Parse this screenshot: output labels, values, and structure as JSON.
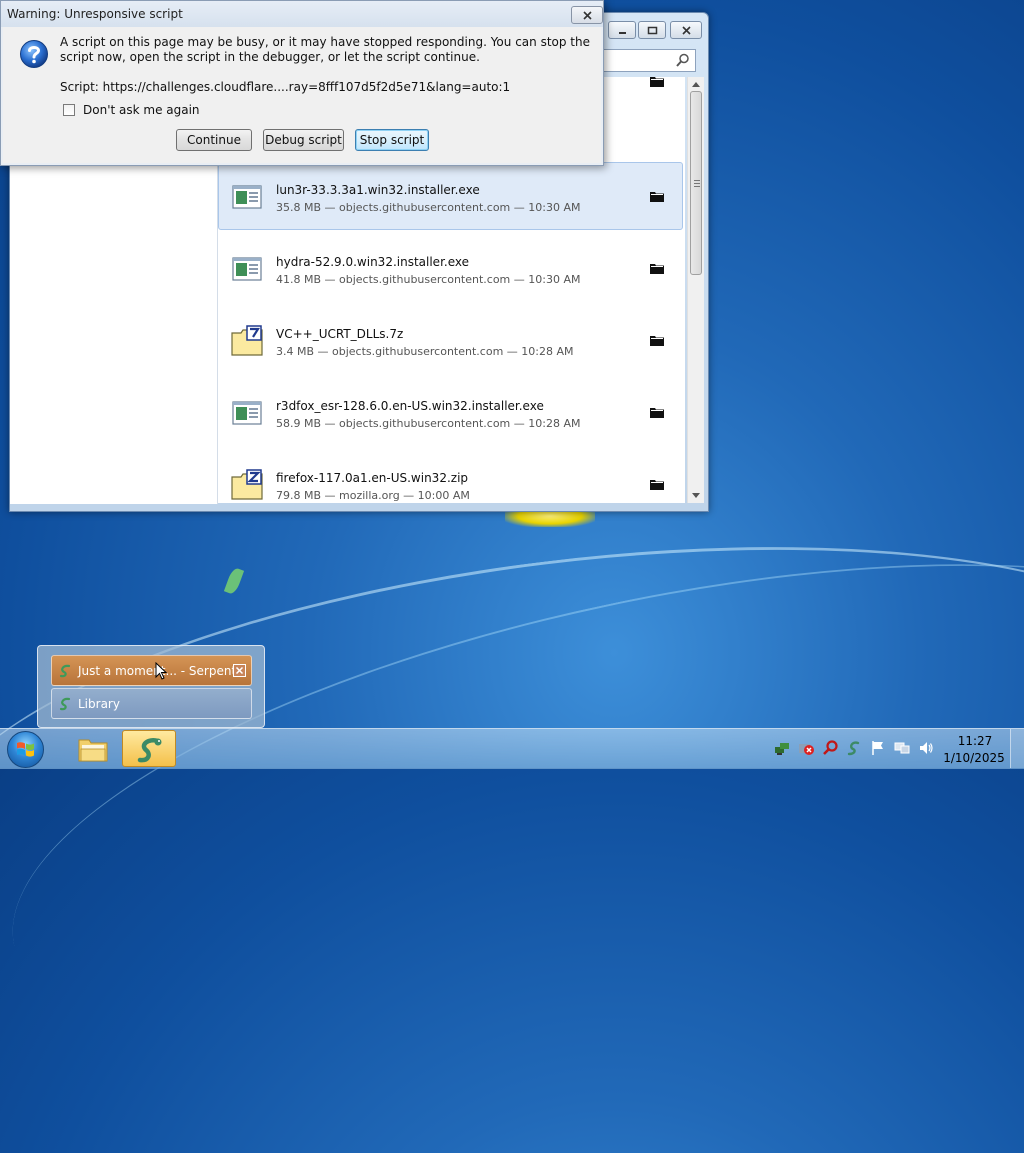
{
  "dialog": {
    "title": "Warning: Unresponsive script",
    "message": "A script on this page may be busy, or it may have stopped responding. You can stop the script now, open the script in the debugger, or let the script continue.",
    "script_line": "Script: https://challenges.cloudflare....ray=8fff107d5f2d5e71&lang=auto:1",
    "checkbox_label": "Don't ask me again",
    "checkbox_checked": false,
    "buttons": {
      "continue": "Continue",
      "debug": "Debug script",
      "stop": "Stop script"
    }
  },
  "downloads": [
    {
      "name": "lun3r-33.3.3a1.win32.installer.exe",
      "status": "35.8 MB — objects.githubusercontent.com — 10:30 AM",
      "icon": "exe-icon",
      "selected": true
    },
    {
      "name": "hydra-52.9.0.win32.installer.exe",
      "status": "41.8 MB — objects.githubusercontent.com — 10:30 AM",
      "icon": "exe-icon",
      "selected": false
    },
    {
      "name": "VC++_UCRT_DLLs.7z",
      "status": "3.4 MB — objects.githubusercontent.com — 10:28 AM",
      "icon": "7z-archive-icon",
      "selected": false
    },
    {
      "name": "r3dfox_esr-128.6.0.en-US.win32.installer.exe",
      "status": "58.9 MB — objects.githubusercontent.com — 10:28 AM",
      "icon": "exe-icon",
      "selected": false
    },
    {
      "name": "firefox-117.0a1.en-US.win32.zip",
      "status": "79.8 MB — mozilla.org — 10:00 AM",
      "icon": "zip-archive-icon",
      "selected": false
    }
  ],
  "taskbar_popup": {
    "items": [
      {
        "label": "Just a moment... - Serpent",
        "active": true
      },
      {
        "label": "Library",
        "active": false
      }
    ]
  },
  "clock": {
    "time": "11:27",
    "date": "1/10/2025"
  },
  "tray_icons": [
    "network-icon",
    "security-alert-icon",
    "search-icon",
    "serpent-icon",
    "action-center-flag-icon",
    "display-icon",
    "volume-icon"
  ]
}
